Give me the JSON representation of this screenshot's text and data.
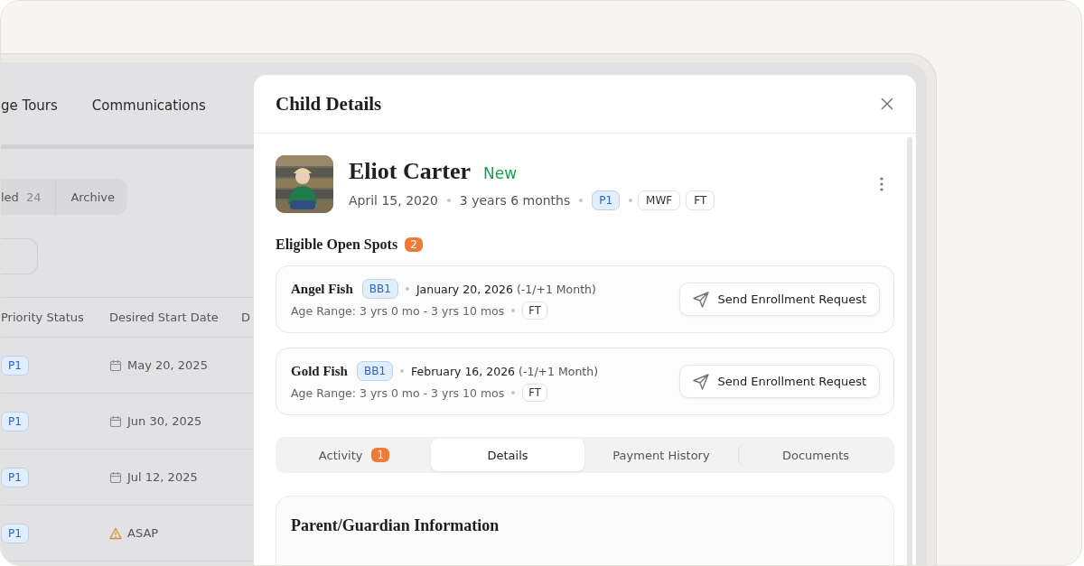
{
  "background_app": {
    "nav_tabs": [
      "ge Tours",
      "Communications"
    ],
    "segments": [
      {
        "label": "led",
        "count": "24"
      },
      {
        "label": "Archive"
      }
    ],
    "table": {
      "columns": [
        "Priority Status",
        "Desired Start Date",
        "D"
      ],
      "rows": [
        {
          "priority": "P1",
          "start_date": "May 20, 2025",
          "urgent": false
        },
        {
          "priority": "P1",
          "start_date": "Jun 30, 2025",
          "urgent": false
        },
        {
          "priority": "P1",
          "start_date": "Jul 12, 2025",
          "urgent": false
        },
        {
          "priority": "P1",
          "start_date": "ASAP",
          "urgent": true
        }
      ]
    }
  },
  "modal": {
    "title": "Child Details",
    "child": {
      "name": "Eliot Carter",
      "status": "New",
      "birth_date": "April 15, 2020",
      "age": "3 years 6 months",
      "priority": "P1",
      "tags": [
        "MWF",
        "FT"
      ]
    },
    "open_spots": {
      "title": "Eligible Open Spots",
      "count": "2",
      "items": [
        {
          "class_name": "Angel Fish",
          "room": "BB1",
          "date": "January 20, 2026",
          "window": "(-1/+1 Month)",
          "age_range": "Age Range: 3 yrs 0 mo - 3 yrs 10 mos",
          "schedule": "FT",
          "action": "Send Enrollment Request"
        },
        {
          "class_name": "Gold Fish",
          "room": "BB1",
          "date": "February 16, 2026",
          "window": "(-1/+1 Month)",
          "age_range": "Age Range: 3 yrs 0 mo - 3 yrs 10 mos",
          "schedule": "FT",
          "action": "Send Enrollment Request"
        }
      ]
    },
    "tabs": [
      {
        "label": "Activity",
        "badge": "1",
        "selected": false
      },
      {
        "label": "Details",
        "selected": true
      },
      {
        "label": "Payment History",
        "selected": false
      },
      {
        "label": "Documents",
        "selected": false
      }
    ],
    "section": {
      "title": "Parent/Guardian Information"
    }
  }
}
